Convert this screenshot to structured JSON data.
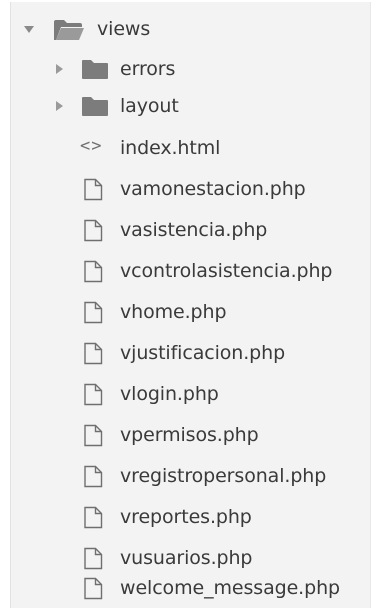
{
  "tree": {
    "root": {
      "label": "views",
      "icon": "folder-open-icon",
      "expanded": true
    },
    "folders": [
      {
        "label": "errors",
        "icon": "folder-icon",
        "expanded": false
      },
      {
        "label": "layout",
        "icon": "folder-icon",
        "expanded": false
      }
    ],
    "files": [
      {
        "label": "index.html",
        "icon": "code-icon"
      },
      {
        "label": "vamonestacion.php",
        "icon": "file-icon"
      },
      {
        "label": "vasistencia.php",
        "icon": "file-icon"
      },
      {
        "label": "vcontrolasistencia.php",
        "icon": "file-icon"
      },
      {
        "label": "vhome.php",
        "icon": "file-icon"
      },
      {
        "label": "vjustificacion.php",
        "icon": "file-icon"
      },
      {
        "label": "vlogin.php",
        "icon": "file-icon"
      },
      {
        "label": "vpermisos.php",
        "icon": "file-icon"
      },
      {
        "label": "vregistropersonal.php",
        "icon": "file-icon"
      },
      {
        "label": "vreportes.php",
        "icon": "file-icon"
      },
      {
        "label": "vusuarios.php",
        "icon": "file-icon"
      },
      {
        "label": "welcome_message.php",
        "icon": "file-icon"
      }
    ],
    "colors": {
      "panel_background": "#f3f3f3",
      "text": "#3a3a3a",
      "folder": "#8a8a8a",
      "icon_stroke": "#6f6f6f"
    }
  }
}
